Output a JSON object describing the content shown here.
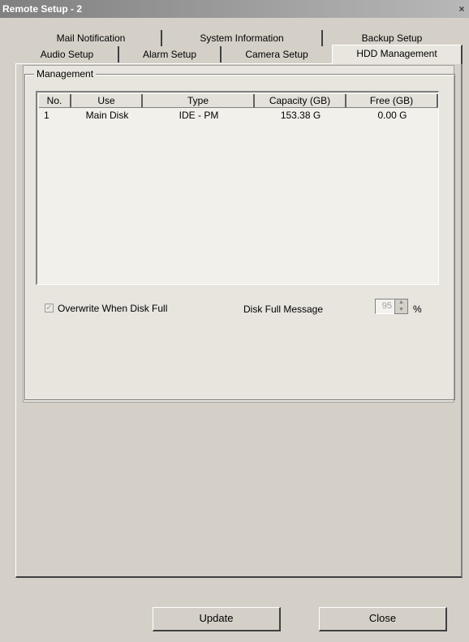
{
  "window": {
    "title": "Remote Setup - 2",
    "close_glyph": "×"
  },
  "tabs": {
    "row_back": [
      "Mail Notification",
      "System Information",
      "Backup Setup"
    ],
    "row_front": [
      "Audio Setup",
      "Alarm Setup",
      "Camera Setup",
      "HDD Management"
    ],
    "active": "HDD Management"
  },
  "management": {
    "legend": "Management",
    "columns": [
      "No.",
      "Use",
      "Type",
      "Capacity (GB)",
      "Free (GB)"
    ],
    "rows": [
      {
        "no": "1",
        "use": "Main Disk",
        "type": "IDE - PM",
        "capacity": "153.38 G",
        "free": "0.00 G"
      }
    ],
    "overwrite_label": "Overwrite When Disk Full",
    "overwrite_checked": true,
    "disk_full_label": "Disk Full Message",
    "disk_full_value": "95",
    "disk_full_unit": "%"
  },
  "buttons": {
    "update": "Update",
    "close": "Close"
  },
  "icons": {
    "check": "✓",
    "up": "▲",
    "down": "▼"
  }
}
